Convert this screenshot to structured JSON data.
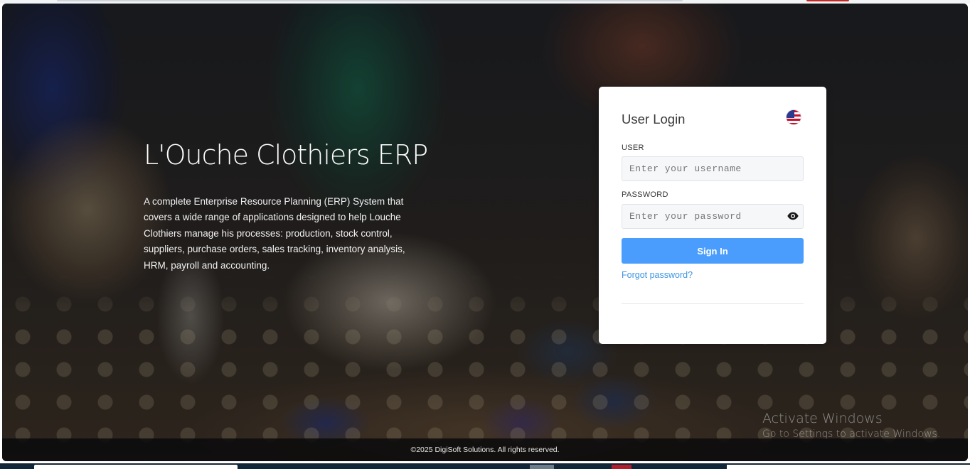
{
  "hero": {
    "title": "L'Ouche Clothiers ERP",
    "description": "A complete Enterprise Resource Planning (ERP) System that covers a wide range of applications designed to help Louche Clothiers manage his processes: production, stock control, suppliers, purchase orders, sales tracking, inventory analysis, HRM, payroll and accounting."
  },
  "login": {
    "title": "User Login",
    "language_icon": "us-flag-icon",
    "user_label": "USER",
    "user_placeholder": "Enter your username",
    "password_label": "PASSWORD",
    "password_placeholder": "Enter your password",
    "password_toggle_icon": "eye-icon",
    "signin_label": "Sign In",
    "forgot_label": "Forgot password?"
  },
  "watermark": {
    "title": "Activate Windows",
    "subtitle": "Go to Settings to activate Windows."
  },
  "footer": {
    "copyright": "©2025 DigiSoft Solutions. All rights reserved."
  },
  "colors": {
    "primary_button": "#4a9dfc",
    "link": "#3c95e3",
    "card_background": "#ffffff",
    "footer_background": "#0a0a0c"
  }
}
